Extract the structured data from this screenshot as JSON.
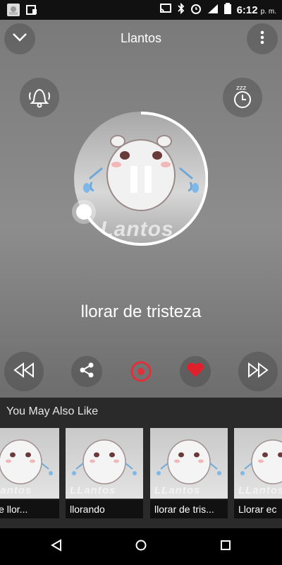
{
  "status_bar": {
    "time": "6:12",
    "ampm": "p. m.",
    "icons": [
      "gallery-icon",
      "screen-icon",
      "cast-icon",
      "bluetooth-icon",
      "alarm-icon",
      "signal-icon",
      "battery-icon"
    ]
  },
  "player": {
    "title": "Llantos",
    "song_title": "llorar de tristeza",
    "art_logo": "LLantos",
    "icons": {
      "collapse": "chevron-down-icon",
      "menu": "more-vert-icon",
      "notify": "bell-icon",
      "sleep": "sleep-timer-icon",
      "play_pause": "pause-icon",
      "rewind": "rewind-icon",
      "share": "share-icon",
      "record": "record-icon",
      "favorite": "heart-icon",
      "forward": "fast-forward-icon"
    },
    "colors": {
      "favorite": "#e0202b",
      "record": "#e0303a"
    }
  },
  "recommendations": {
    "heading": "You May Also Like",
    "brand": "LLantos",
    "items": [
      {
        "label": "mbre llor..."
      },
      {
        "label": "llorando"
      },
      {
        "label": "llorar de tris..."
      },
      {
        "label": "Llorar ec"
      }
    ]
  },
  "nav_bar": {
    "icons": [
      "back-icon",
      "home-icon",
      "recents-icon"
    ]
  }
}
